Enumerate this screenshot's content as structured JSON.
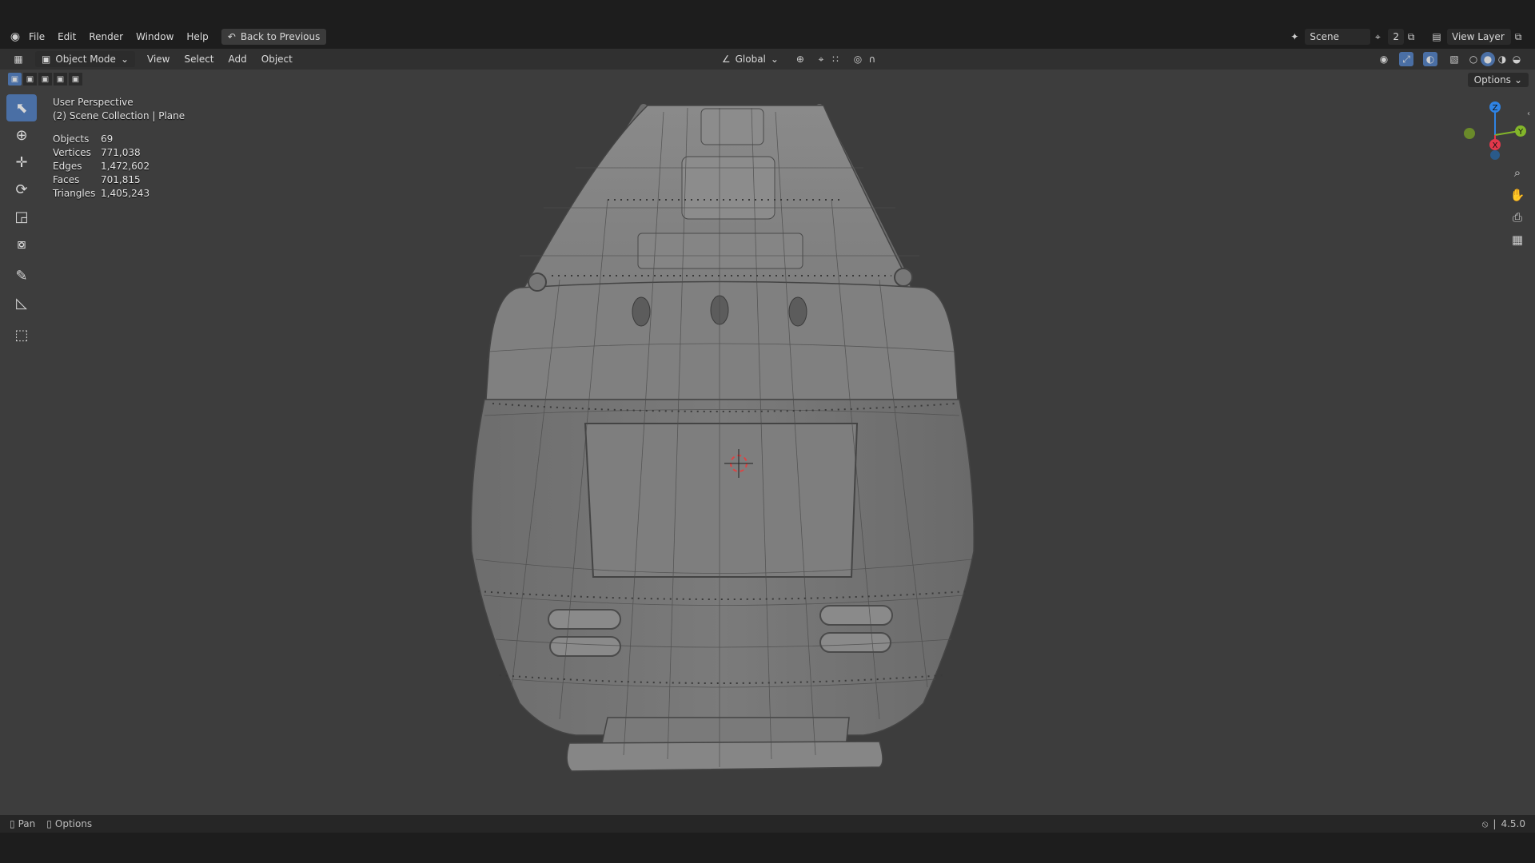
{
  "app": {
    "menus": [
      "File",
      "Edit",
      "Render",
      "Window",
      "Help"
    ],
    "back_button": "Back to Previous",
    "scene_name": "Scene",
    "scene_users": "2",
    "view_layer": "View Layer"
  },
  "header": {
    "mode": "Object Mode",
    "menus": [
      "View",
      "Select",
      "Add",
      "Object"
    ],
    "orientation": "Global",
    "options": "Options"
  },
  "overlay": {
    "view_name": "User Perspective",
    "collection": "(2) Scene Collection | Plane",
    "stats": [
      {
        "label": "Objects",
        "value": "69"
      },
      {
        "label": "Vertices",
        "value": "771,038"
      },
      {
        "label": "Edges",
        "value": "1,472,602"
      },
      {
        "label": "Faces",
        "value": "701,815"
      },
      {
        "label": "Triangles",
        "value": "1,405,243"
      }
    ]
  },
  "gizmo": {
    "z": "Z",
    "y": "Y",
    "x": "X"
  },
  "statusbar": {
    "pan": "Pan",
    "options": "Options",
    "version": "4.5.0"
  },
  "colors": {
    "viewport_bg": "#3d3d3d",
    "accent": "#4a6fa5",
    "axis_x": "#e3384b",
    "axis_y": "#83b62a",
    "axis_z": "#2f83e4"
  },
  "icons": {
    "toolbar": [
      "select-box-icon",
      "cursor-icon",
      "move-icon",
      "rotate-icon",
      "scale-icon",
      "transform-icon",
      "annotate-icon",
      "measure-icon",
      "add-cube-icon"
    ],
    "nav": [
      "zoom-icon",
      "pan-hand-icon",
      "camera-icon",
      "grid-icon"
    ]
  }
}
